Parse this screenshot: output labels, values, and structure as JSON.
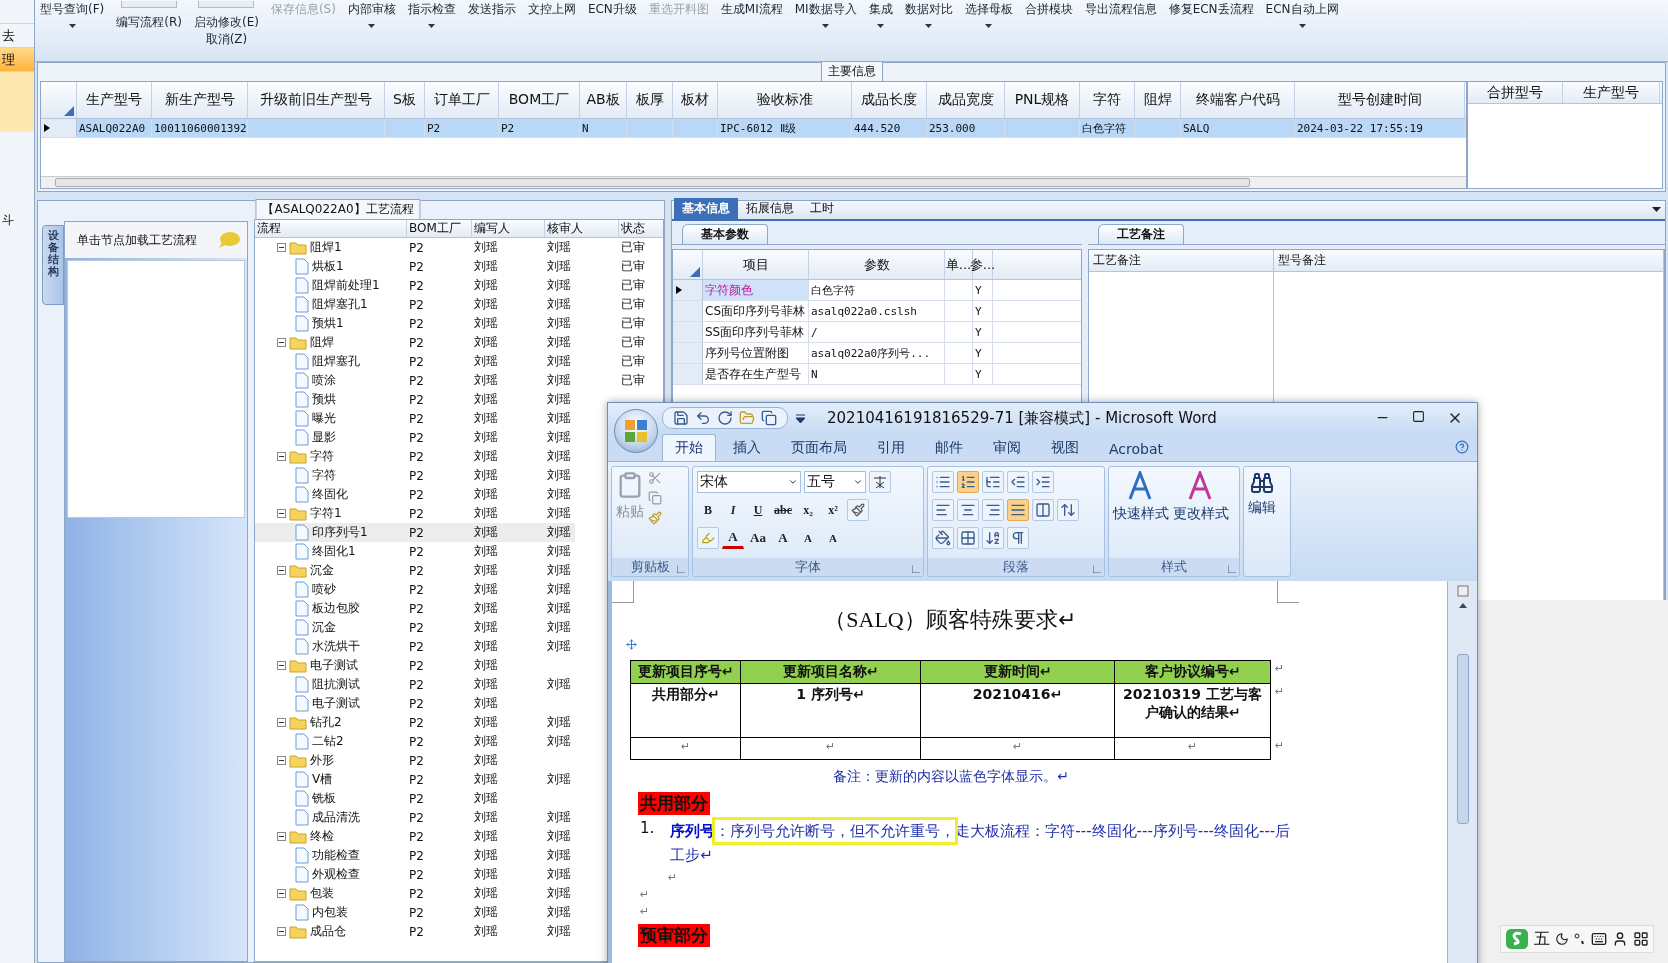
{
  "left_strip": {
    "items": [
      {
        "label": "去",
        "selected": false
      },
      {
        "label": "理",
        "selected": true
      }
    ],
    "bottom_label": "斗"
  },
  "toolbar": [
    {
      "label": "型号查询(F)",
      "kind": "plain",
      "disabled": false,
      "dropdown": true
    },
    {
      "label": "编写流程(R)",
      "kind": "lowered",
      "disabled": false,
      "dropdown": false
    },
    {
      "label": "启动修改(E)",
      "sublabel": "取消(Z)",
      "kind": "lowered",
      "disabled": false,
      "dropdown": false
    },
    {
      "label": "保存信息(S)",
      "kind": "plain",
      "disabled": true,
      "dropdown": false
    },
    {
      "label": "内部审核",
      "kind": "plain",
      "disabled": false,
      "dropdown": true
    },
    {
      "label": "指示检查",
      "kind": "plain",
      "disabled": false,
      "dropdown": true
    },
    {
      "label": "发送指示",
      "kind": "plain",
      "disabled": false,
      "dropdown": false
    },
    {
      "label": "文控上网",
      "kind": "plain",
      "disabled": false,
      "dropdown": false
    },
    {
      "label": "ECN升级",
      "kind": "plain",
      "disabled": false,
      "dropdown": false
    },
    {
      "label": "重选开料图",
      "kind": "plain",
      "disabled": true,
      "dropdown": false
    },
    {
      "label": "生成MI流程",
      "kind": "plain",
      "disabled": false,
      "dropdown": false
    },
    {
      "label": "MI数据导入",
      "kind": "plain",
      "disabled": false,
      "dropdown": true
    },
    {
      "label": "集成",
      "kind": "plain",
      "disabled": false,
      "dropdown": true
    },
    {
      "label": "数据对比",
      "kind": "plain",
      "disabled": false,
      "dropdown": true
    },
    {
      "label": "选择母板",
      "kind": "plain",
      "disabled": false,
      "dropdown": true
    },
    {
      "label": "合拼模块",
      "kind": "plain",
      "disabled": false,
      "dropdown": false
    },
    {
      "label": "导出流程信息",
      "kind": "plain",
      "disabled": false,
      "dropdown": false
    },
    {
      "label": "修复ECN丢流程",
      "kind": "plain",
      "disabled": false,
      "dropdown": false
    },
    {
      "label": "ECN自动上网",
      "kind": "plain",
      "disabled": false,
      "dropdown": true
    }
  ],
  "main_info": {
    "title": "主要信息",
    "columns": [
      "生产型号",
      "新生产型号",
      "升级前旧生产型号",
      "S板",
      "订单工厂",
      "BOM工厂",
      "AB板",
      "板厚",
      "板材",
      "验收标准",
      "成品长度",
      "成品宽度",
      "PNL规格",
      "字符",
      "阻焊",
      "终端客户代码",
      "型号创建时间"
    ],
    "rows": [
      {
        "selected": true,
        "cells": [
          "ASALQ022A0",
          "10011060001392",
          "",
          "",
          "P2",
          "P2",
          "N",
          "",
          "",
          "IPC-6012 Ⅱ级",
          "444.520",
          "253.000",
          "",
          "白色字符",
          "",
          "SALQ",
          "2024-03-22 17:55:19"
        ]
      }
    ],
    "side_columns": [
      "合拼型号",
      "生产型号"
    ]
  },
  "process": {
    "title": "【ASALQ022A0】工艺流程",
    "side_tab": "设备结构",
    "nav_hint": "单击节点加载工艺流程",
    "columns": [
      "流程",
      "BOM工厂",
      "编写人",
      "核审人",
      "状态"
    ],
    "rows": [
      {
        "name": "阻焊1",
        "kind": "folder",
        "expanded": true,
        "selected": false,
        "bom": "P2",
        "writer": "刘瑶",
        "reviewer": "刘瑶",
        "status": "已审",
        "children": [
          {
            "name": "烘板1",
            "kind": "step",
            "selected": false,
            "bom": "P2",
            "writer": "刘瑶",
            "reviewer": "刘瑶",
            "status": "已审"
          },
          {
            "name": "阻焊前处理1",
            "kind": "step",
            "selected": false,
            "bom": "P2",
            "writer": "刘瑶",
            "reviewer": "刘瑶",
            "status": "已审"
          },
          {
            "name": "阻焊塞孔1",
            "kind": "step",
            "selected": false,
            "bom": "P2",
            "writer": "刘瑶",
            "reviewer": "刘瑶",
            "status": "已审"
          },
          {
            "name": "预烘1",
            "kind": "step",
            "selected": false,
            "bom": "P2",
            "writer": "刘瑶",
            "reviewer": "刘瑶",
            "status": "已审"
          }
        ]
      },
      {
        "name": "阻焊",
        "kind": "folder",
        "expanded": true,
        "selected": false,
        "bom": "P2",
        "writer": "刘瑶",
        "reviewer": "刘瑶",
        "status": "已审",
        "children": [
          {
            "name": "阻焊塞孔",
            "kind": "step",
            "selected": false,
            "bom": "P2",
            "writer": "刘瑶",
            "reviewer": "刘瑶",
            "status": "已审"
          },
          {
            "name": "喷涂",
            "kind": "step",
            "selected": false,
            "bom": "P2",
            "writer": "刘瑶",
            "reviewer": "刘瑶",
            "status": "已审"
          },
          {
            "name": "预烘",
            "kind": "step",
            "selected": false,
            "bom": "P2",
            "writer": "刘瑶",
            "reviewer": "刘瑶"
          },
          {
            "name": "曝光",
            "kind": "step",
            "selected": false,
            "bom": "P2",
            "writer": "刘瑶",
            "reviewer": "刘瑶"
          },
          {
            "name": "显影",
            "kind": "step",
            "selected": false,
            "bom": "P2",
            "writer": "刘瑶",
            "reviewer": "刘瑶"
          }
        ]
      },
      {
        "name": "字符",
        "kind": "folder",
        "expanded": true,
        "selected": false,
        "bom": "P2",
        "writer": "刘瑶",
        "reviewer": "刘瑶",
        "children": [
          {
            "name": "字符",
            "kind": "step",
            "selected": false,
            "bom": "P2",
            "writer": "刘瑶",
            "reviewer": "刘瑶"
          },
          {
            "name": "终固化",
            "kind": "step",
            "selected": false,
            "bom": "P2",
            "writer": "刘瑶",
            "reviewer": "刘瑶"
          }
        ]
      },
      {
        "name": "字符1",
        "kind": "folder",
        "expanded": true,
        "selected": false,
        "bom": "P2",
        "writer": "刘瑶",
        "reviewer": "刘瑶",
        "children": [
          {
            "name": "印序列号1",
            "kind": "step",
            "selected": true,
            "bom": "P2",
            "writer": "刘瑶",
            "reviewer": "刘瑶"
          },
          {
            "name": "终固化1",
            "kind": "step",
            "selected": false,
            "bom": "P2",
            "writer": "刘瑶",
            "reviewer": "刘瑶"
          }
        ]
      },
      {
        "name": "沉金",
        "kind": "folder",
        "expanded": true,
        "selected": false,
        "bom": "P2",
        "writer": "刘瑶",
        "reviewer": "刘瑶",
        "children": [
          {
            "name": "喷砂",
            "kind": "step",
            "selected": false,
            "bom": "P2",
            "writer": "刘瑶",
            "reviewer": "刘瑶"
          },
          {
            "name": "板边包胶",
            "kind": "step",
            "selected": false,
            "bom": "P2",
            "writer": "刘瑶",
            "reviewer": "刘瑶"
          },
          {
            "name": "沉金",
            "kind": "step",
            "selected": false,
            "bom": "P2",
            "writer": "刘瑶",
            "reviewer": "刘瑶"
          },
          {
            "name": "水洗烘干",
            "kind": "step",
            "selected": false,
            "bom": "P2",
            "writer": "刘瑶",
            "reviewer": "刘瑶"
          }
        ]
      },
      {
        "name": "电子测试",
        "kind": "folder",
        "expanded": true,
        "selected": false,
        "bom": "P2",
        "writer": "刘瑶",
        "children": [
          {
            "name": "阻抗测试",
            "kind": "step",
            "selected": false,
            "bom": "P2",
            "writer": "刘瑶",
            "reviewer": "刘瑶"
          },
          {
            "name": "电子测试",
            "kind": "step",
            "selected": false,
            "bom": "P2",
            "writer": "刘瑶"
          }
        ]
      },
      {
        "name": "钻孔2",
        "kind": "folder",
        "expanded": true,
        "selected": false,
        "bom": "P2",
        "writer": "刘瑶",
        "reviewer": "刘瑶",
        "children": [
          {
            "name": "二钻2",
            "kind": "step",
            "selected": false,
            "bom": "P2",
            "writer": "刘瑶",
            "reviewer": "刘瑶"
          }
        ]
      },
      {
        "name": "外形",
        "kind": "folder",
        "expanded": true,
        "selected": false,
        "bom": "P2",
        "writer": "刘瑶",
        "children": [
          {
            "name": "V槽",
            "kind": "step",
            "selected": false,
            "bom": "P2",
            "writer": "刘瑶",
            "reviewer": "刘瑶"
          },
          {
            "name": "铣板",
            "kind": "step",
            "selected": false,
            "bom": "P2",
            "writer": "刘瑶"
          },
          {
            "name": "成品清洗",
            "kind": "step",
            "selected": false,
            "bom": "P2",
            "writer": "刘瑶",
            "reviewer": "刘瑶"
          }
        ]
      },
      {
        "name": "终检",
        "kind": "folder",
        "expanded": true,
        "selected": false,
        "bom": "P2",
        "writer": "刘瑶",
        "reviewer": "刘瑶",
        "children": [
          {
            "name": "功能检查",
            "kind": "step",
            "selected": false,
            "bom": "P2",
            "writer": "刘瑶",
            "reviewer": "刘瑶"
          },
          {
            "name": "外观检查",
            "kind": "step",
            "selected": false,
            "bom": "P2",
            "writer": "刘瑶",
            "reviewer": "刘瑶"
          }
        ]
      },
      {
        "name": "包装",
        "kind": "folder",
        "expanded": true,
        "selected": false,
        "bom": "P2",
        "writer": "刘瑶",
        "reviewer": "刘瑶",
        "children": [
          {
            "name": "内包装",
            "kind": "step",
            "selected": false,
            "bom": "P2",
            "writer": "刘瑶",
            "reviewer": "刘瑶"
          }
        ]
      },
      {
        "name": "成品仓",
        "kind": "folder",
        "expanded": true,
        "selected": false,
        "bom": "P2",
        "writer": "刘瑶",
        "reviewer": "刘瑶"
      }
    ]
  },
  "detail": {
    "tabs": [
      {
        "label": "基本信息",
        "selected": true
      },
      {
        "label": "拓展信息",
        "selected": false
      },
      {
        "label": "工时",
        "selected": false
      }
    ],
    "params": {
      "tab": "基本参数",
      "columns": [
        "项目",
        "参数",
        "单...",
        "参..."
      ],
      "rows": [
        {
          "item": "字符颜色",
          "value": "白色字符",
          "flag": "Y",
          "selected": true
        },
        {
          "item": "CS面印序列号菲林",
          "value": "asalq022a0.cslsh",
          "flag": "Y",
          "selected": false
        },
        {
          "item": "SS面印序列号菲林",
          "value": "/",
          "flag": "Y",
          "selected": false
        },
        {
          "item": "序列号位置附图",
          "value": "asalq022a0序列号...",
          "flag": "Y",
          "selected": false
        },
        {
          "item": "是否存在生产型号",
          "value": "N",
          "flag": "Y",
          "selected": false
        }
      ]
    },
    "remarks": {
      "tab": "工艺备注",
      "columns": [
        "工艺备注",
        "型号备注"
      ]
    }
  },
  "word": {
    "title": "20210416191816529-71 [兼容模式] - Microsoft Word",
    "tabs": [
      {
        "label": "开始",
        "selected": true
      },
      {
        "label": "插入",
        "selected": false
      },
      {
        "label": "页面布局",
        "selected": false
      },
      {
        "label": "引用",
        "selected": false
      },
      {
        "label": "邮件",
        "selected": false
      },
      {
        "label": "审阅",
        "selected": false
      },
      {
        "label": "视图",
        "selected": false
      },
      {
        "label": "Acrobat",
        "selected": false
      }
    ],
    "paste_label": "粘贴",
    "font_name": "宋体",
    "font_size": "五号",
    "format_buttons": [
      "B",
      "I",
      "U",
      "abc",
      "x₂",
      "x²"
    ],
    "font_row2": [
      "A",
      "Aa",
      "A",
      "A",
      "A"
    ],
    "styles": [
      "快速样式",
      "更改样式"
    ],
    "edit_label": "编辑",
    "groups": [
      "剪贴板",
      "字体",
      "段落",
      "样式"
    ],
    "doc": {
      "title": "（SALQ）顾客特殊要求↵",
      "table": {
        "columns": [
          "更新项目序号↵",
          "更新项目名称↵",
          "更新时间↵",
          "客户协议编号↵"
        ],
        "rows": [
          [
            "共用部分↵",
            "1 序列号↵",
            "20210416↵",
            "20210319 工艺与客户确认的结果↵"
          ],
          [
            "↵",
            "↵",
            "↵",
            "↵"
          ]
        ],
        "row_mark": "↵"
      },
      "note": "备注：更新的内容以蓝色字体显示。↵",
      "section": "共用部分",
      "item": {
        "number": "1.",
        "lead": "序列号",
        "boxed": "：序列号允许断号，但不允许重号，",
        "rest": "走大板流程：字符---终固化---序列号---终固化---后工步↵"
      },
      "blank_lines": [
        {
          "text": "↵",
          "indented": true
        },
        {
          "text": "↵",
          "indented": false
        },
        {
          "text": "↵",
          "indented": false
        }
      ],
      "next_section": "预审部分"
    }
  },
  "ime": {
    "label": "五"
  }
}
